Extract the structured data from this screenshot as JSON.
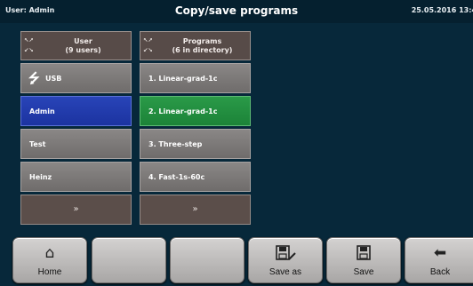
{
  "header": {
    "user": "User: Admin",
    "title": "Copy/save programs",
    "date": "25.05.2016 13:4"
  },
  "users_list": {
    "title": "User",
    "subtitle": "(9 users)",
    "usb_label": "USB",
    "items": [
      "Admin",
      "Test",
      "Heinz"
    ],
    "selected": "Admin",
    "scroll_icon": "double-chevron-down-icon"
  },
  "programs_list": {
    "title": "Programs",
    "subtitle": "(6 in directory)",
    "items": [
      "1. Linear-grad-1c",
      "2. Linear-grad-1c",
      "3. Three-step",
      "4. Fast-1s-60c"
    ],
    "selected": "2. Linear-grad-1c",
    "scroll_icon": "double-chevron-down-icon"
  },
  "footer": {
    "home": "Home",
    "save_as": "Save as",
    "save": "Save",
    "back": "Back"
  },
  "colors": {
    "background": "#07283a",
    "selected_user": "#2540b0",
    "selected_program": "#249040"
  }
}
